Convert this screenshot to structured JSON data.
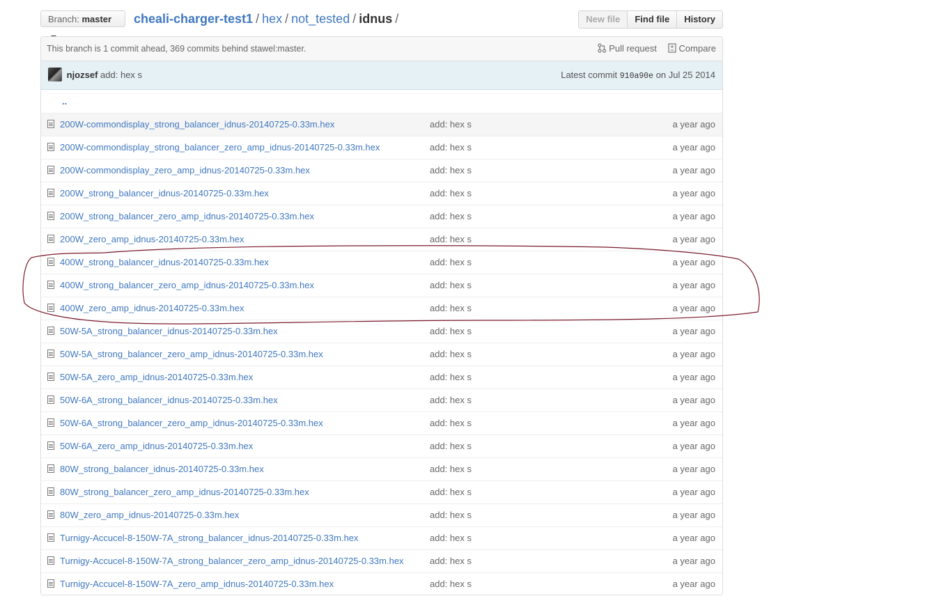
{
  "branch": {
    "label": "Branch:",
    "name": "master"
  },
  "breadcrumb": {
    "repo": "cheali-charger-test1",
    "separator": "/",
    "parts": [
      "hex",
      "not_tested"
    ],
    "current": "idnus"
  },
  "toolbar": {
    "new_file": "New file",
    "find_file": "Find file",
    "history": "History"
  },
  "branch_info": {
    "text": "This branch is 1 commit ahead, 369 commits behind stawel:master.",
    "pull_request": "Pull request",
    "compare": "Compare"
  },
  "commit": {
    "author": "njozsef",
    "message": "add: hex s",
    "latest_label": "Latest commit",
    "sha": "910a90e",
    "date": "on Jul 25 2014"
  },
  "parent_dir": "..",
  "files": [
    {
      "name": "200W-commondisplay_strong_balancer_idnus-20140725-0.33m.hex",
      "message": "add: hex s",
      "age": "a year ago"
    },
    {
      "name": "200W-commondisplay_strong_balancer_zero_amp_idnus-20140725-0.33m.hex",
      "message": "add: hex s",
      "age": "a year ago"
    },
    {
      "name": "200W-commondisplay_zero_amp_idnus-20140725-0.33m.hex",
      "message": "add: hex s",
      "age": "a year ago"
    },
    {
      "name": "200W_strong_balancer_idnus-20140725-0.33m.hex",
      "message": "add: hex s",
      "age": "a year ago"
    },
    {
      "name": "200W_strong_balancer_zero_amp_idnus-20140725-0.33m.hex",
      "message": "add: hex s",
      "age": "a year ago"
    },
    {
      "name": "200W_zero_amp_idnus-20140725-0.33m.hex",
      "message": "add: hex s",
      "age": "a year ago"
    },
    {
      "name": "400W_strong_balancer_idnus-20140725-0.33m.hex",
      "message": "add: hex s",
      "age": "a year ago"
    },
    {
      "name": "400W_strong_balancer_zero_amp_idnus-20140725-0.33m.hex",
      "message": "add: hex s",
      "age": "a year ago"
    },
    {
      "name": "400W_zero_amp_idnus-20140725-0.33m.hex",
      "message": "add: hex s",
      "age": "a year ago"
    },
    {
      "name": "50W-5A_strong_balancer_idnus-20140725-0.33m.hex",
      "message": "add: hex s",
      "age": "a year ago"
    },
    {
      "name": "50W-5A_strong_balancer_zero_amp_idnus-20140725-0.33m.hex",
      "message": "add: hex s",
      "age": "a year ago"
    },
    {
      "name": "50W-5A_zero_amp_idnus-20140725-0.33m.hex",
      "message": "add: hex s",
      "age": "a year ago"
    },
    {
      "name": "50W-6A_strong_balancer_idnus-20140725-0.33m.hex",
      "message": "add: hex s",
      "age": "a year ago"
    },
    {
      "name": "50W-6A_strong_balancer_zero_amp_idnus-20140725-0.33m.hex",
      "message": "add: hex s",
      "age": "a year ago"
    },
    {
      "name": "50W-6A_zero_amp_idnus-20140725-0.33m.hex",
      "message": "add: hex s",
      "age": "a year ago"
    },
    {
      "name": "80W_strong_balancer_idnus-20140725-0.33m.hex",
      "message": "add: hex s",
      "age": "a year ago"
    },
    {
      "name": "80W_strong_balancer_zero_amp_idnus-20140725-0.33m.hex",
      "message": "add: hex s",
      "age": "a year ago"
    },
    {
      "name": "80W_zero_amp_idnus-20140725-0.33m.hex",
      "message": "add: hex s",
      "age": "a year ago"
    },
    {
      "name": "Turnigy-Accucel-8-150W-7A_strong_balancer_idnus-20140725-0.33m.hex",
      "message": "add: hex s",
      "age": "a year ago"
    },
    {
      "name": "Turnigy-Accucel-8-150W-7A_strong_balancer_zero_amp_idnus-20140725-0.33m.hex",
      "message": "add: hex s",
      "age": "a year ago"
    },
    {
      "name": "Turnigy-Accucel-8-150W-7A_zero_amp_idnus-20140725-0.33m.hex",
      "message": "add: hex s",
      "age": "a year ago"
    }
  ],
  "colors": {
    "link": "#4078c0",
    "commit_bg": "#e6f1f6",
    "annotation": "#7a1a2a"
  }
}
